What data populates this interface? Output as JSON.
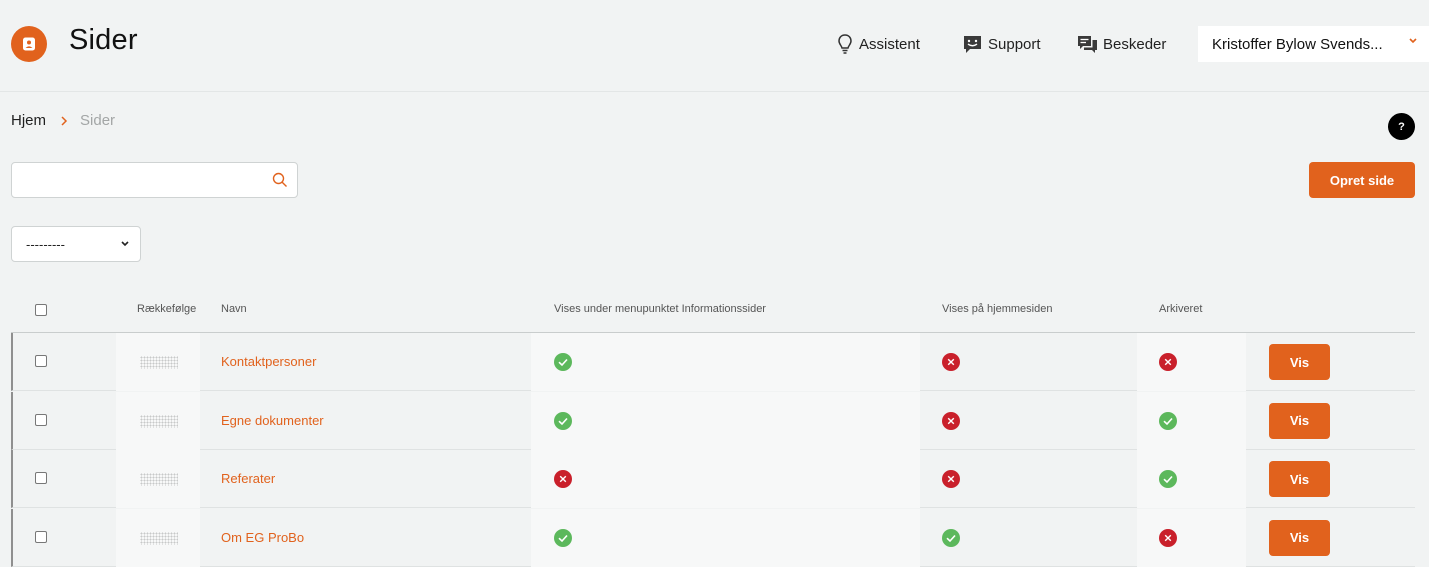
{
  "header": {
    "title": "Sider",
    "assistant_label": "Assistent",
    "support_label": "Support",
    "messages_label": "Beskeder",
    "user_name": "Kristoffer Bylow Svends..."
  },
  "breadcrumb": {
    "home": "Hjem",
    "current": "Sider"
  },
  "help_label": "?",
  "search": {
    "placeholder": "",
    "value": ""
  },
  "create_button": "Opret side",
  "filter": {
    "selected": "---------"
  },
  "colors": {
    "accent": "#e1621d",
    "success": "#5cb85c",
    "danger": "#c9202b"
  },
  "table": {
    "columns": {
      "order": "Rækkefølge",
      "name": "Navn",
      "info": "Vises under menupunktet Informationssider",
      "homepage": "Vises på hjemmesiden",
      "archived": "Arkiveret"
    },
    "rows": [
      {
        "name": "Kontaktpersoner",
        "info": true,
        "homepage": false,
        "archived": false,
        "action": "Vis"
      },
      {
        "name": "Egne dokumenter",
        "info": true,
        "homepage": false,
        "archived": true,
        "action": "Vis"
      },
      {
        "name": "Referater",
        "info": false,
        "homepage": false,
        "archived": true,
        "action": "Vis"
      },
      {
        "name": "Om EG ProBo",
        "info": true,
        "homepage": true,
        "archived": false,
        "action": "Vis"
      }
    ]
  }
}
